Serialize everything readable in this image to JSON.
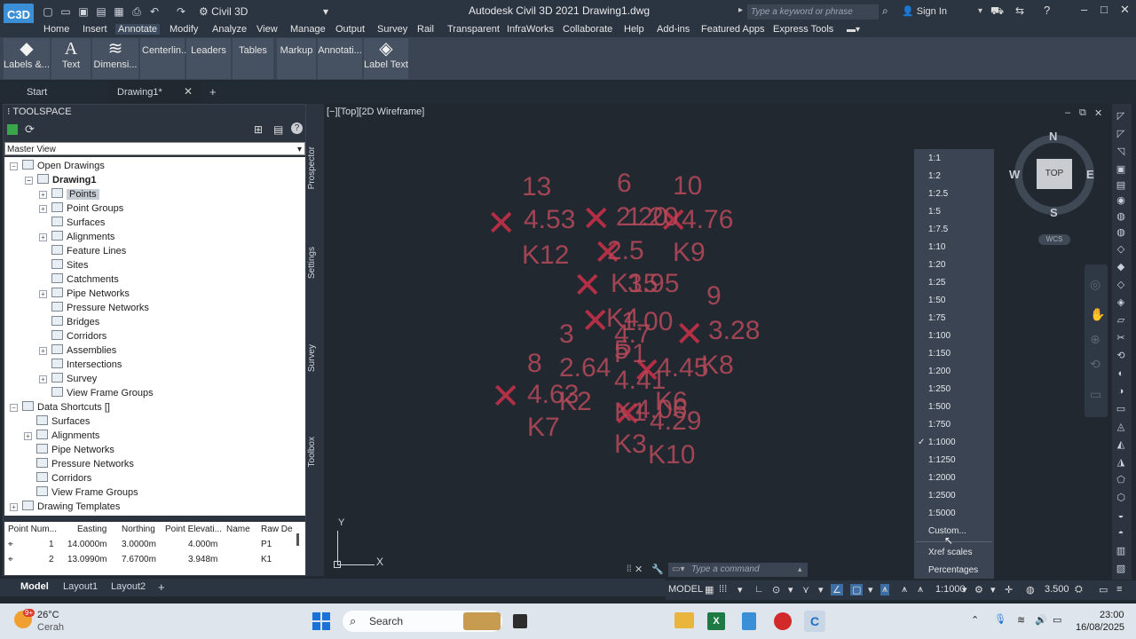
{
  "titlebar": {
    "logo": "C3D",
    "workspace": "Civil 3D",
    "title": "Autodesk Civil 3D 2021   Drawing1.dwg",
    "search_placeholder": "Type a keyword or phrase",
    "signin": "Sign In"
  },
  "menu": [
    "Home",
    "Insert",
    "Annotate",
    "Modify",
    "Analyze",
    "View",
    "Manage",
    "Output",
    "Survey",
    "Rail",
    "Transparent",
    "InfraWorks",
    "Collaborate",
    "Help",
    "Add-ins",
    "Featured Apps",
    "Express Tools"
  ],
  "ribbon": {
    "labels": "Labels &...",
    "text": "Text",
    "dimensions": "Dimensi...",
    "centerlines": "Centerlin...",
    "leaders": "Leaders",
    "tables": "Tables",
    "markup": "Markup",
    "annotation": "Annotati...",
    "label_text": "Label Text"
  },
  "filetabs": {
    "start": "Start",
    "drawing": "Drawing1*"
  },
  "toolspace": {
    "title": "TOOLSPACE",
    "view": "Master View",
    "sidetabs": [
      "Prospector",
      "Settings",
      "Survey",
      "Toolbox"
    ],
    "tree": [
      "Open Drawings",
      "Drawing1",
      "Points",
      "Point Groups",
      "Surfaces",
      "Alignments",
      "Feature Lines",
      "Sites",
      "Catchments",
      "Pipe Networks",
      "Pressure Networks",
      "Bridges",
      "Corridors",
      "Assemblies",
      "Intersections",
      "Survey",
      "View Frame Groups",
      "Data Shortcuts []",
      "Surfaces",
      "Alignments",
      "Pipe Networks",
      "Pressure Networks",
      "Corridors",
      "View Frame Groups",
      "Drawing Templates"
    ]
  },
  "grid": {
    "headers": [
      "Point Num...",
      "Easting",
      "Northing",
      "Point Elevati...",
      "Name",
      "Raw De"
    ],
    "rows": [
      [
        "1",
        "14.0000m",
        "3.0000m",
        "4.000m",
        "P1"
      ],
      [
        "2",
        "13.0990m",
        "7.6700m",
        "3.948m",
        "K1"
      ]
    ]
  },
  "viewport": {
    "label": "[−][Top][2D Wireframe]",
    "texts": [
      "13",
      "4.53",
      "K12",
      "6",
      "2.20",
      "1.20",
      "2.5",
      "10",
      "4.76",
      "K9",
      "K15",
      "3.95",
      "9",
      "K4",
      "1.00",
      "4.7",
      "3.28",
      "3",
      "8",
      "2.64",
      "5",
      "P1",
      "4.45",
      "K8",
      "4.41",
      "4.29",
      "K6",
      "K2",
      "4.63",
      "K7",
      "K1",
      "4.06",
      "K3",
      "K10"
    ]
  },
  "viewcube": {
    "n": "N",
    "s": "S",
    "e": "E",
    "w": "W",
    "top": "TOP",
    "wcs": "WCS"
  },
  "scales": [
    "1:1",
    "1:2",
    "1:2.5",
    "1:5",
    "1:7.5",
    "1:10",
    "1:20",
    "1:25",
    "1:50",
    "1:75",
    "1:100",
    "1:150",
    "1:200",
    "1:250",
    "1:500",
    "1:750",
    "1:1000",
    "1:1250",
    "1:2000",
    "1:2500",
    "1:5000",
    "Custom...",
    "Xref scales",
    "Percentages"
  ],
  "selected_scale": "1:1000",
  "command": {
    "placeholder": "Type a command"
  },
  "layouts": [
    "Model",
    "Layout1",
    "Layout2"
  ],
  "status": {
    "model": "MODEL",
    "scale": "1:1000",
    "value": "3.500"
  },
  "taskbar": {
    "temp": "26°C",
    "weather": "Cerah",
    "badge": "9+",
    "search": "Search",
    "time": "23:00",
    "date": "16/08/2025"
  },
  "colors": {
    "accent": "#3a8fd6",
    "point": "#b22f45",
    "background": "#212830"
  }
}
